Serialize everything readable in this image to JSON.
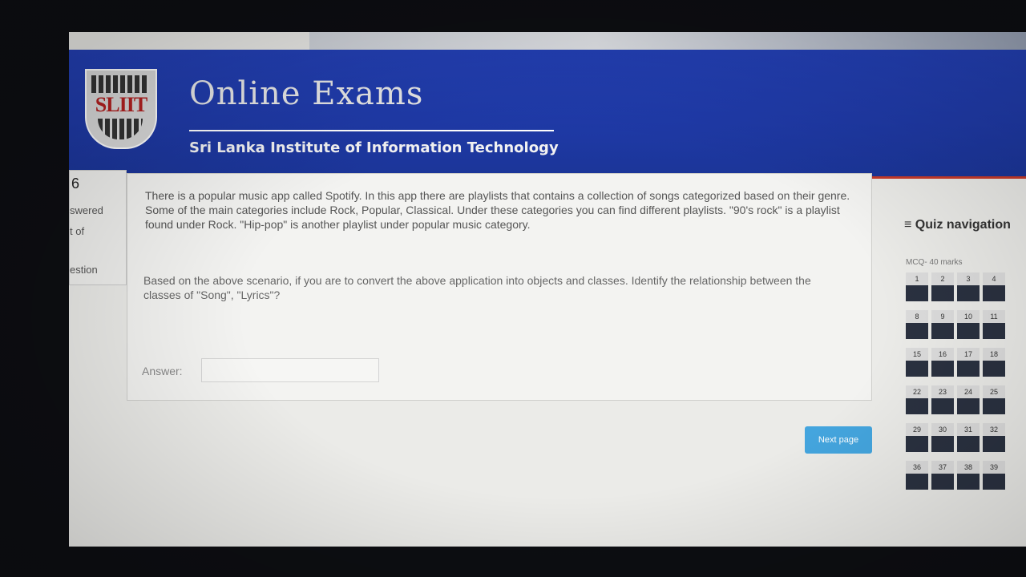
{
  "header": {
    "logo_text": "SLIIT",
    "title": "Online Exams",
    "subtitle": "Sri Lanka Institute of Information Technology"
  },
  "info_box": {
    "number": "6",
    "line1": "swered",
    "line2": "t of",
    "line3": "estion"
  },
  "question": {
    "text": "There is a popular music app called Spotify. In this app there are playlists that contains a collection of songs categorized based on their genre. Some of the main categories include Rock, Popular, Classical. Under these categories you can find different playlists. \"90's rock\" is a playlist found under Rock. \"Hip-pop\" is another playlist under popular music category.",
    "prompt": "Based on the above scenario, if you are to convert the above application into objects and classes. Identify the relationship between the classes of \"Song\", \"Lyrics\"?",
    "answer_label": "Answer:",
    "answer_value": ""
  },
  "actions": {
    "next_label": "Next page"
  },
  "quiz_nav": {
    "title": "≡ Quiz navigation",
    "subtitle": "MCQ- 40 marks",
    "rows": [
      [
        "1",
        "2",
        "3",
        "4"
      ],
      [
        "8",
        "9",
        "10",
        "11"
      ],
      [
        "15",
        "16",
        "17",
        "18"
      ],
      [
        "22",
        "23",
        "24",
        "25"
      ],
      [
        "29",
        "30",
        "31",
        "32"
      ],
      [
        "36",
        "37",
        "38",
        "39"
      ]
    ]
  }
}
